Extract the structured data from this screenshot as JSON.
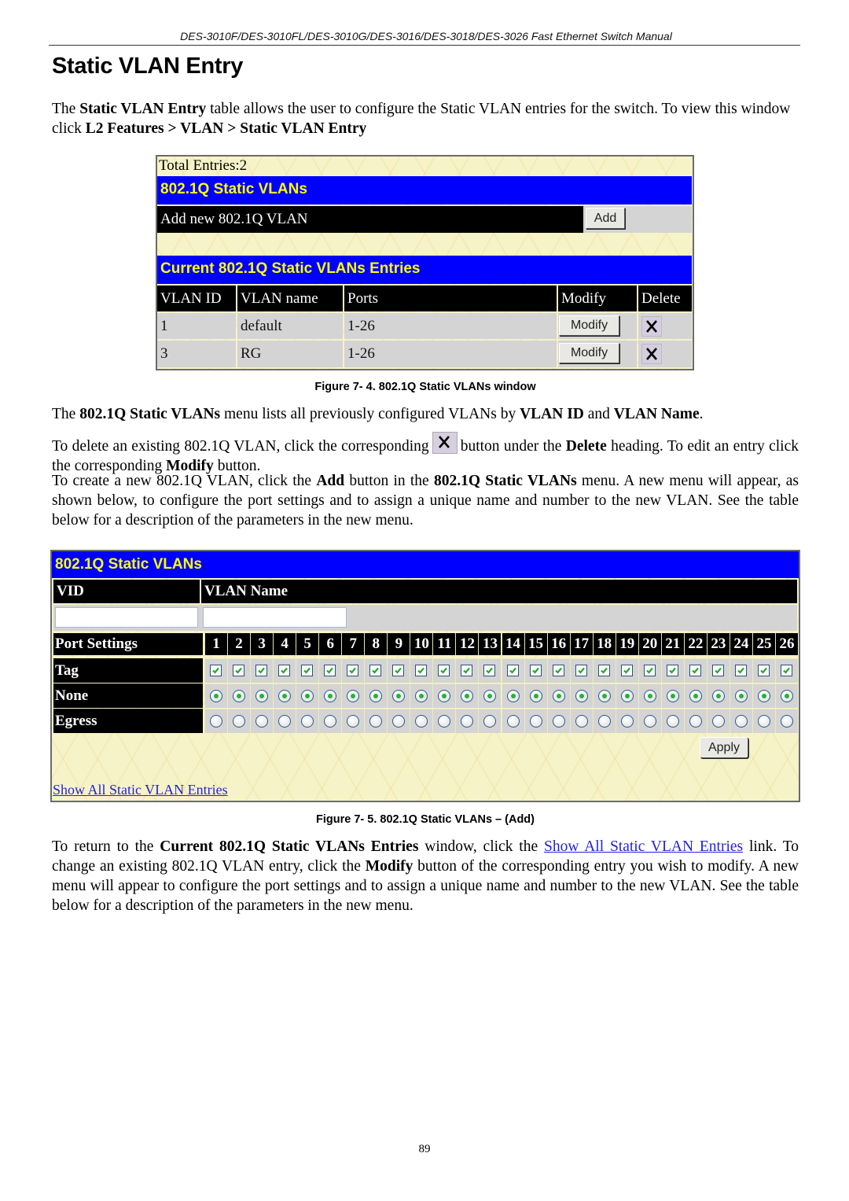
{
  "running_header": "DES-3010F/DES-3010FL/DES-3010G/DES-3016/DES-3018/DES-3026 Fast Ethernet Switch Manual",
  "page_title": "Static VLAN Entry",
  "intro": {
    "t1": "The ",
    "b1": "Static VLAN Entry",
    "t2": " table allows the user to configure the Static VLAN entries for the switch. To view this window click ",
    "b2": "L2 Features > VLAN > Static VLAN Entry"
  },
  "figure1": {
    "total_entries": "Total Entries:2",
    "title_bar": "802.1Q Static VLANs",
    "add_row_label": "Add new 802.1Q VLAN",
    "add_button": "Add",
    "entries_bar": "Current 802.1Q Static VLANs Entries",
    "columns": [
      "VLAN ID",
      "VLAN name",
      "Ports",
      "Modify",
      "Delete"
    ],
    "rows": [
      {
        "vlan_id": "1",
        "vlan_name": "default",
        "ports": "1-26",
        "modify": "Modify"
      },
      {
        "vlan_id": "3",
        "vlan_name": "RG",
        "ports": "1-26",
        "modify": "Modify"
      }
    ],
    "caption": "Figure 7- 4. 802.1Q Static VLANs window"
  },
  "para2": {
    "t1": "The ",
    "b1": "802.1Q Static VLANs",
    "t2": " menu lists all previously configured VLANs by ",
    "b2": "VLAN ID",
    "t3": " and ",
    "b3": "VLAN Name",
    "t4": "."
  },
  "para3": {
    "t1": "To delete an existing 802.1Q VLAN, click the corresponding",
    "t2": "button under the ",
    "b1": "Delete",
    "t3": " heading. To edit an entry click the corresponding ",
    "b2": "Modify",
    "t4": " button."
  },
  "para4": {
    "t1": "To create a new 802.1Q VLAN, click the ",
    "b1": "Add",
    "t2": " button in the ",
    "b2": "802.1Q Static VLANs",
    "t3": " menu. A new menu will appear, as shown below, to configure the port settings and to assign a unique name and number to the new VLAN. See the table below for a description of the parameters in the new menu."
  },
  "figure2": {
    "title_bar": "802.1Q Static VLANs",
    "vid_label": "VID",
    "vlan_name_label": "VLAN Name",
    "vid_value": "",
    "vlan_name_value": "",
    "port_settings_label": "Port Settings",
    "ports": [
      "1",
      "2",
      "3",
      "4",
      "5",
      "6",
      "7",
      "8",
      "9",
      "10",
      "11",
      "12",
      "13",
      "14",
      "15",
      "16",
      "17",
      "18",
      "19",
      "20",
      "21",
      "22",
      "23",
      "24",
      "25",
      "26"
    ],
    "tag_label": "Tag",
    "none_label": "None",
    "egress_label": "Egress",
    "tag_checked": true,
    "mode_selected": "None",
    "apply_button": "Apply",
    "show_all_link": "Show All Static VLAN Entries",
    "caption": "Figure 7- 5. 802.1Q Static VLANs – (Add)"
  },
  "para5": {
    "t1": "To return to the ",
    "b1": "Current 802.1Q Static VLANs Entries",
    "t2": " window, click the ",
    "link": "Show All Static VLAN Entries",
    "t3": " link. To change an existing 802.1Q VLAN entry, click the ",
    "b2": "Modify",
    "t4": " button of the corresponding entry you wish to modify. A new menu will appear to configure the port settings and to assign a unique name and number to the new VLAN. See the table below for a description of the parameters in the new menu."
  },
  "page_number": "89",
  "colors": {
    "title_bar_bg": "#0000ff",
    "title_bar_text": "#ffff00",
    "header_bg": "#000000",
    "cell_bg": "#d4d4d4",
    "panel_bg": "#f7f3c8",
    "link": "#2222dd"
  }
}
